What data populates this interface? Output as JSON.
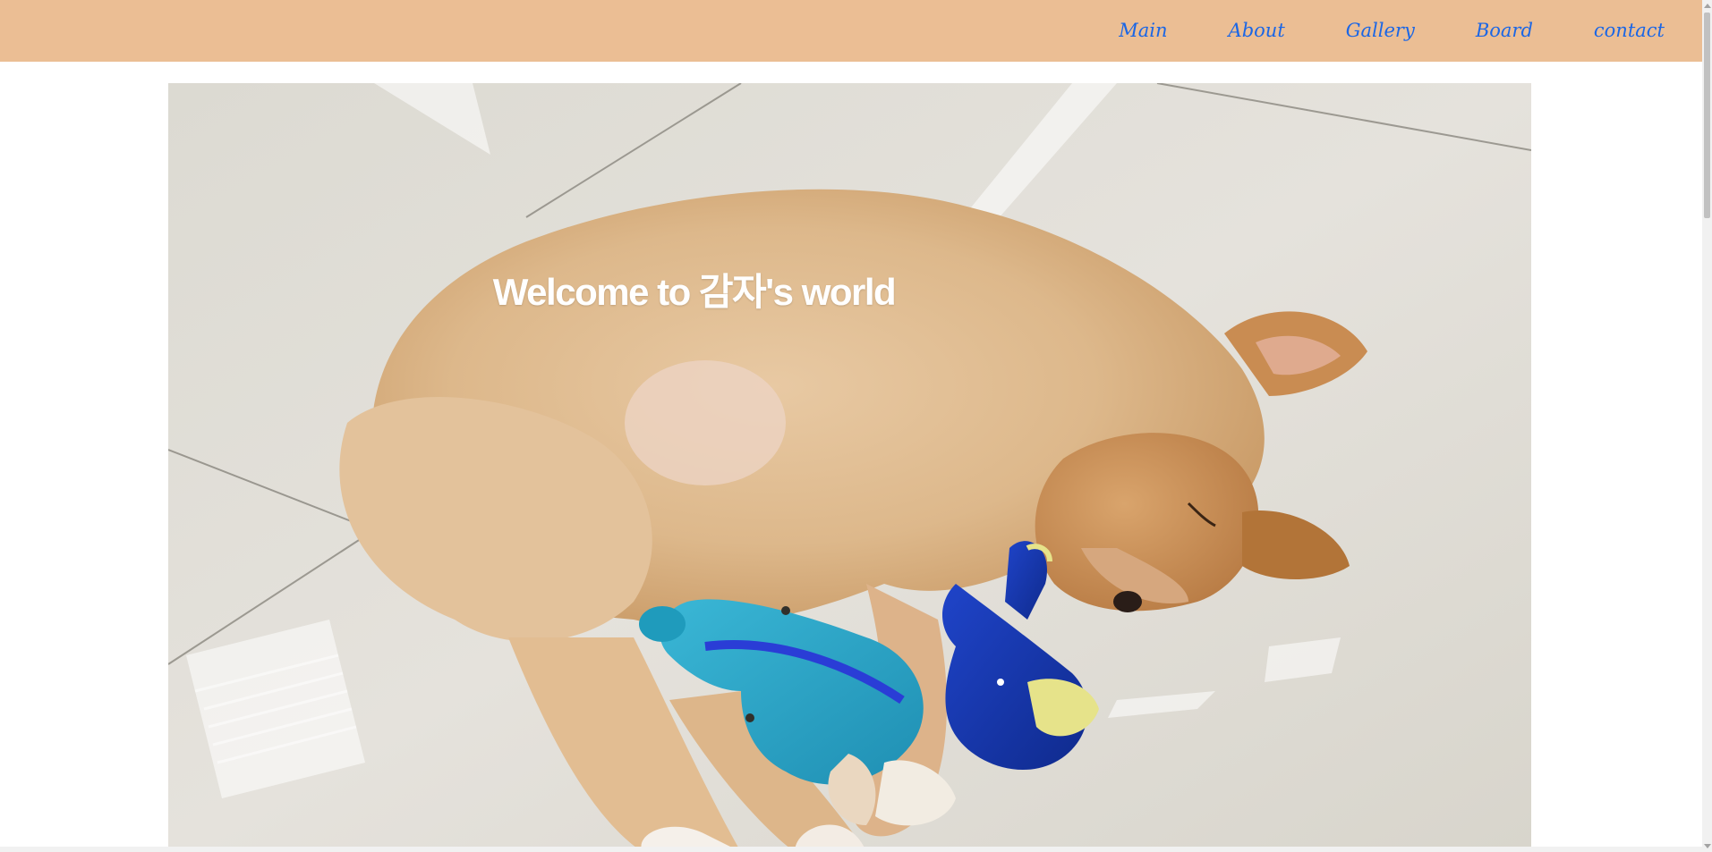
{
  "nav": {
    "items": [
      {
        "label": "Main"
      },
      {
        "label": "About"
      },
      {
        "label": "Gallery"
      },
      {
        "label": "Board"
      },
      {
        "label": "contact"
      }
    ]
  },
  "hero": {
    "title": "Welcome to 감자's world",
    "image_subject": "sleeping-puppy-with-toy"
  },
  "colors": {
    "navbar_bg": "#ebbe94",
    "nav_link": "#1a66e6",
    "title_text": "#ffffff"
  }
}
